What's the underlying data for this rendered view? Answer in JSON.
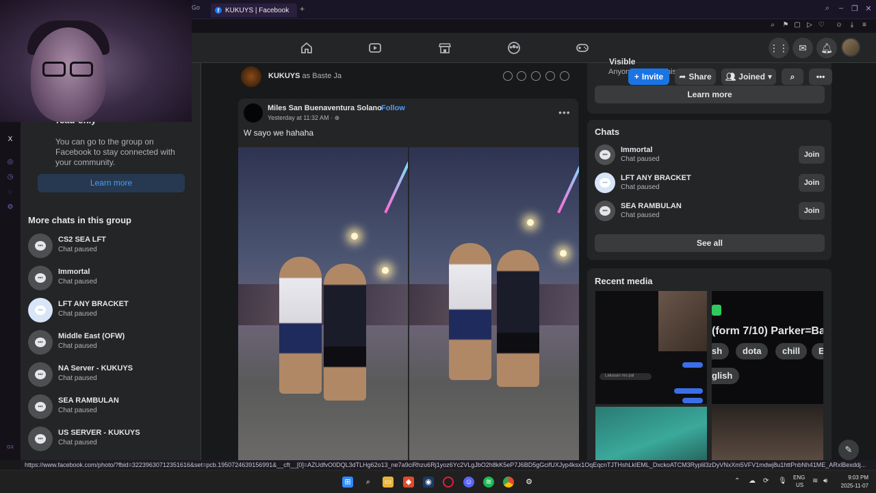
{
  "browser": {
    "prev_tab_label": "Go",
    "active_tab_label": "KUKUYS | Facebook",
    "new_tab": "+"
  },
  "fb_nav": {
    "icons": [
      "home-icon",
      "video-icon",
      "marketplace-icon",
      "groups-icon",
      "gaming-icon"
    ],
    "right_icons": [
      "menu-grid-icon",
      "messenger-icon",
      "notifications-icon"
    ]
  },
  "left_sidebar": {
    "info_title": "read-only",
    "info_text": "You can go to the group on Facebook to stay connected with your community.",
    "learn_more": "Learn more",
    "more_chats_title": "More chats in this group",
    "chats": [
      {
        "name": "CS2 SEA LFT",
        "status": "Chat paused",
        "icon_style": "dark"
      },
      {
        "name": "Immortal",
        "status": "Chat paused",
        "icon_style": "dark"
      },
      {
        "name": "LFT ANY BRACKET",
        "status": "Chat paused",
        "icon_style": "light"
      },
      {
        "name": "Middle East (OFW)",
        "status": "Chat paused",
        "icon_style": "dark"
      },
      {
        "name": "NA Server - KUKUYS",
        "status": "Chat paused",
        "icon_style": "dark"
      },
      {
        "name": "SEA RAMBULAN",
        "status": "Chat paused",
        "icon_style": "dark"
      },
      {
        "name": "US SERVER - KUKUYS",
        "status": "Chat paused",
        "icon_style": "dark"
      }
    ]
  },
  "composer": {
    "group_name": "KUKUYS",
    "text": "as Baste Ja"
  },
  "post": {
    "author": "Miles San Buenaventura Solano",
    "separator": "·",
    "follow": "Follow",
    "time": "Yesterday at 11:32 AM · ",
    "text": "W sayo we hahaha"
  },
  "right_sidebar": {
    "visible_label": "Visible",
    "anyone_text": "Anyone can find this group.",
    "invite": "Invite",
    "share": "Share",
    "joined": "Joined",
    "learn_more": "Learn more",
    "chats_title": "Chats",
    "chats": [
      {
        "name": "Immortal",
        "status": "Chat paused",
        "action": "Join",
        "icon_style": "dark"
      },
      {
        "name": "LFT ANY BRACKET",
        "status": "Chat paused",
        "action": "Join",
        "icon_style": "light"
      },
      {
        "name": "SEA RAMBULAN",
        "status": "Chat paused",
        "action": "Join",
        "icon_style": "dark"
      }
    ],
    "see_all": "See all",
    "recent_media_title": "Recent media",
    "media2_text": "(form 7/10) Parker=Ba",
    "media2_tags": [
      "sh",
      "dota",
      "chill",
      "Es"
    ],
    "media2_tag_last": "glish",
    "media1_caption": "Lakasan mo pal"
  },
  "status_url": "https://www.facebook.com/photo/?fbid=32239630712351616&set=pcb.1950724639156991&__cft__[0]=AZUdfvO0DQL3dTLHg62o13_ne7a9ciRhzu6Rj1yoz6Yc2VLgJbO2h8kK5eP7J6BD5gGcifUXJyp4ksx1OqEqcnTJTHshLkIEML_DxckoATCM3Ryplil3zDyVNxXm5VFV1mdwj8u1httPnbNh41ME_ARxlBexddj...",
  "taskbar": {
    "lang_top": "ENG",
    "lang_bottom": "US",
    "time": "9:03 PM",
    "date": "2025-11-07"
  },
  "colors": {
    "accent_blue": "#1b74e4",
    "link_blue": "#4e9df6",
    "card_bg": "#242526",
    "page_bg": "#18191a"
  }
}
